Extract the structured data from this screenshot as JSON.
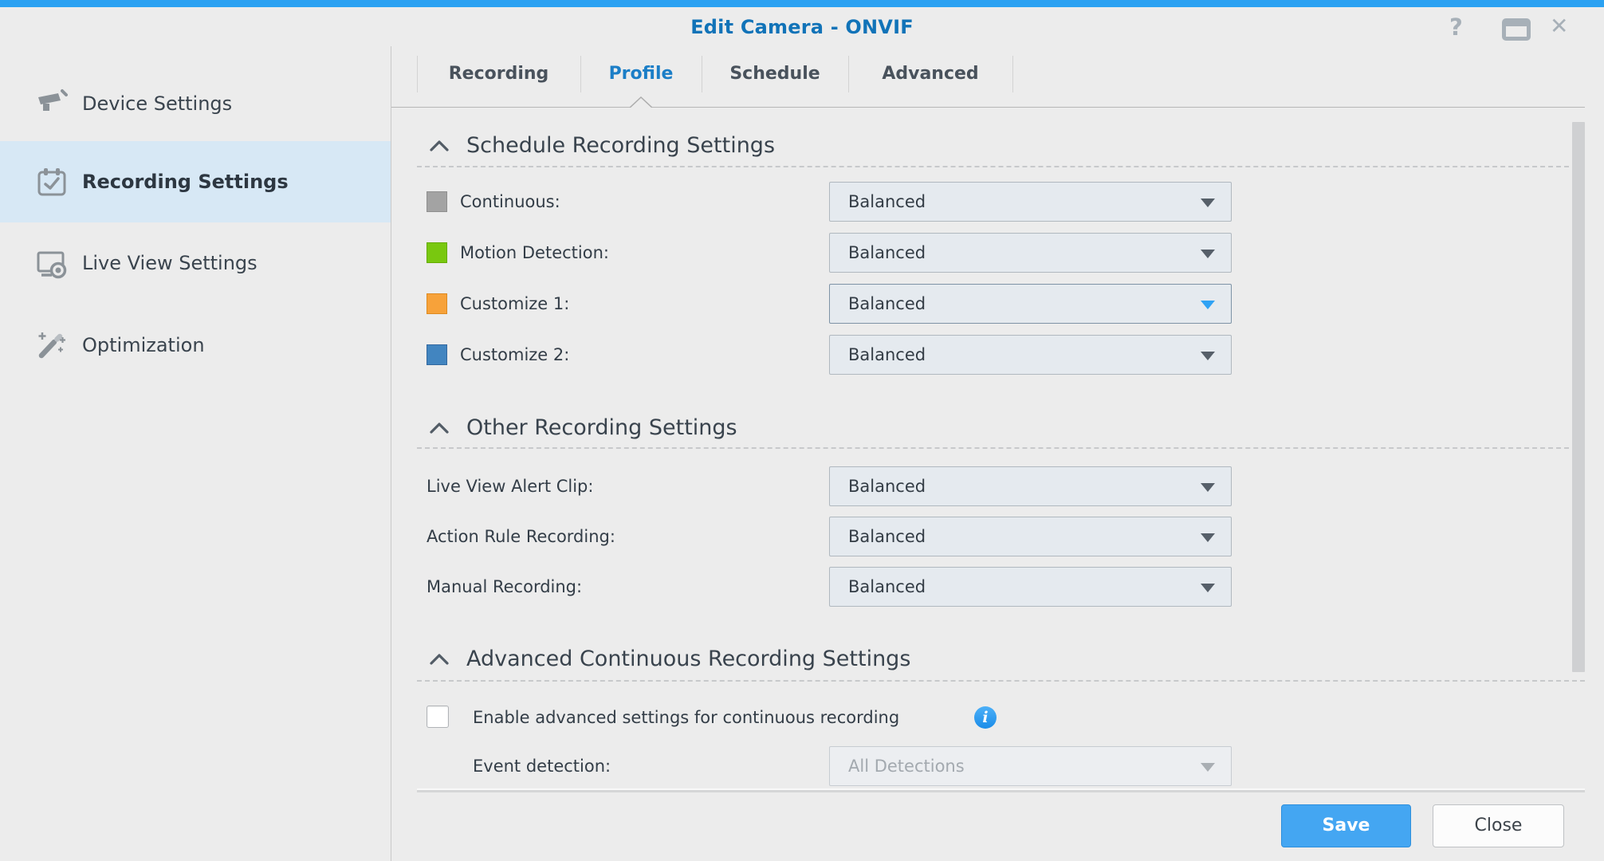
{
  "window": {
    "title": "Edit Camera - ONVIF",
    "help_glyph": "?",
    "close_glyph": "✕"
  },
  "sidebar": {
    "selected_index": 1,
    "items": [
      {
        "label": "Device Settings",
        "icon": "camera-icon"
      },
      {
        "label": "Recording Settings",
        "icon": "calendar-check-icon"
      },
      {
        "label": "Live View Settings",
        "icon": "monitor-camera-icon"
      },
      {
        "label": "Optimization",
        "icon": "magic-wand-icon"
      }
    ]
  },
  "tabs": {
    "active_index": 1,
    "items": [
      {
        "label": "Recording"
      },
      {
        "label": "Profile"
      },
      {
        "label": "Schedule"
      },
      {
        "label": "Advanced"
      }
    ]
  },
  "sections": [
    {
      "title": "Schedule Recording Settings",
      "collapsed": false,
      "rows": [
        {
          "label": "Continuous:",
          "swatch": "#a3a3a3",
          "swatch_border": "#8f8f8f",
          "value": "Balanced",
          "state": "normal"
        },
        {
          "label": "Motion Detection:",
          "swatch": "#79c80f",
          "swatch_border": "#64ab00",
          "value": "Balanced",
          "state": "normal"
        },
        {
          "label": "Customize 1:",
          "swatch": "#f7a23a",
          "swatch_border": "#dd8a21",
          "value": "Balanced",
          "state": "focused"
        },
        {
          "label": "Customize 2:",
          "swatch": "#4285c0",
          "swatch_border": "#33689f",
          "value": "Balanced",
          "state": "normal"
        }
      ]
    },
    {
      "title": "Other Recording Settings",
      "collapsed": false,
      "rows": [
        {
          "label": "Live View Alert Clip:",
          "value": "Balanced",
          "state": "normal"
        },
        {
          "label": "Action Rule Recording:",
          "value": "Balanced",
          "state": "normal"
        },
        {
          "label": "Manual Recording:",
          "value": "Balanced",
          "state": "normal"
        }
      ]
    },
    {
      "title": "Advanced Continuous Recording Settings",
      "collapsed": false,
      "checkbox": {
        "label": "Enable advanced settings for continuous recording",
        "checked": false
      },
      "rows": [
        {
          "label": "Event detection:",
          "value": "All Detections",
          "state": "disabled"
        }
      ]
    }
  ],
  "footer": {
    "save_label": "Save",
    "close_label": "Close"
  },
  "colors": {
    "top_strip": "#2ba1f2",
    "title_text": "#1173b8",
    "sidebar_highlight": "#d7e8f5",
    "active_tab": "#1b7ec7",
    "save_button": "#44a6f2",
    "info_icon": "#2d9ff2",
    "focused_arrow": "#2fa2f4",
    "icon_gray": "#8b9298",
    "background": "#ececec"
  }
}
